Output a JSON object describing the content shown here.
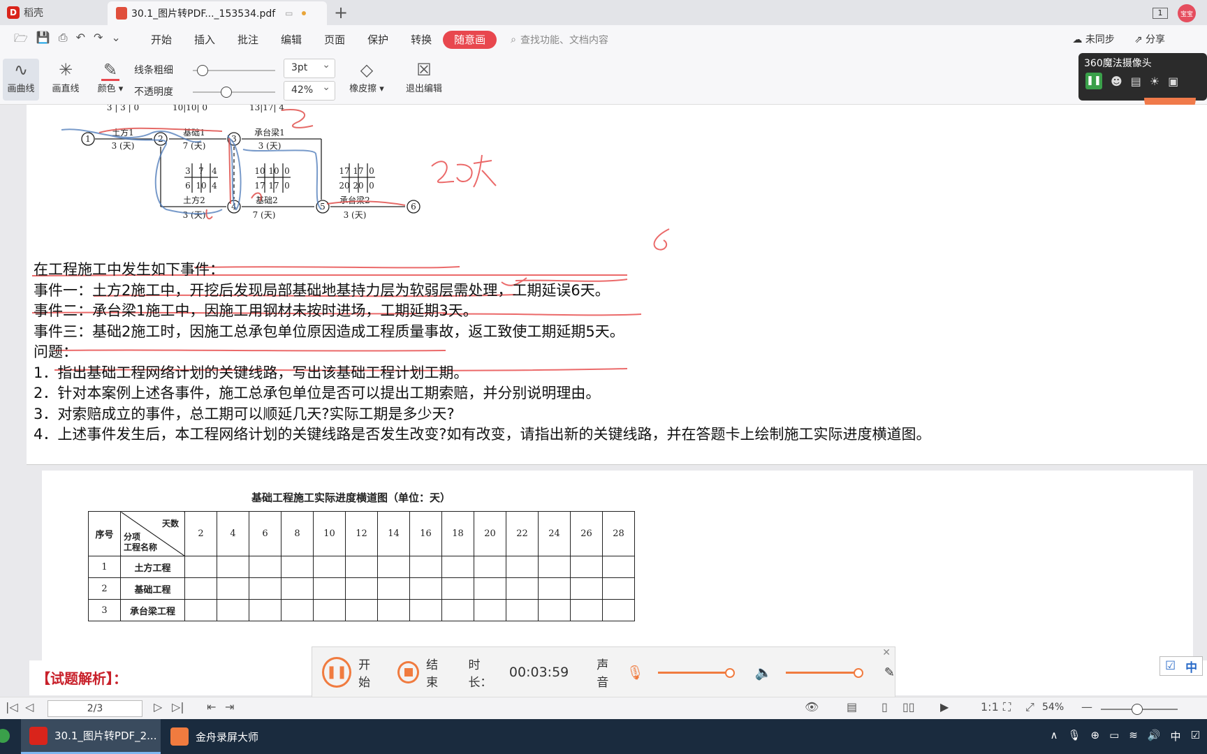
{
  "titlebar": {
    "home_tab": "稻壳",
    "doc_tab": "30.1_图片转PDF..._153534.pdf",
    "window_count": "1",
    "avatar_text": "宝宝"
  },
  "menubar": {
    "items": [
      "开始",
      "插入",
      "批注",
      "编辑",
      "页面",
      "保护",
      "转换",
      "随意画"
    ],
    "active": "随意画",
    "search_placeholder": "查找功能、文档内容",
    "sync": "未同步",
    "share": "分享"
  },
  "drawbar": {
    "freehand": "画曲线",
    "straight": "画直线",
    "color": "颜色",
    "thickness_label": "线条粗细",
    "thickness_value": "3pt",
    "opacity_label": "不透明度",
    "opacity_value": "42%",
    "eraser": "橡皮擦",
    "exit": "退出编辑"
  },
  "camera": {
    "title": "360魔法摄像头"
  },
  "network": {
    "top_labels": [
      {
        "text": "3 | 3 | 0"
      },
      {
        "text": "10|10| 0"
      },
      {
        "text": "13|17| 4"
      }
    ],
    "nodes": [
      "1",
      "2",
      "3",
      "4",
      "5",
      "6"
    ],
    "activities": [
      {
        "name": "土方1",
        "duration": "3 (天)"
      },
      {
        "name": "基础1",
        "duration": "7 (天)"
      },
      {
        "name": "承台梁1",
        "duration": "3 (天)"
      },
      {
        "name": "土方2",
        "duration": "3 (天)"
      },
      {
        "name": "基础2",
        "duration": "7 (天)"
      },
      {
        "name": "承台梁2",
        "duration": "3 (天)"
      }
    ],
    "grid_a": [
      "3",
      "7",
      "4",
      "6",
      "10",
      "4"
    ],
    "grid_b": [
      "10",
      "10",
      "0",
      "17",
      "17",
      "0"
    ],
    "grid_c": [
      "17",
      "17",
      "0",
      "20",
      "20",
      "0"
    ],
    "handwriting": "20天"
  },
  "question": {
    "lines": [
      "在工程施工中发生如下事件：",
      "事件一：土方2施工中，开挖后发现局部基础地基持力层为软弱层需处理，工期延误6天。",
      "事件二：承台梁1施工中，因施工用钢材未按时进场，工期延期3天。",
      "事件三：基础2施工时，因施工总承包单位原因造成工程质量事故，返工致使工期延期5天。",
      "问题：",
      "1．指出基础工程网络计划的关键线路，写出该基础工程计划工期。",
      "2．针对本案例上述各事件，施工总承包单位是否可以提出工期索赔，并分别说明理由。",
      "3．对索赔成立的事件，总工期可以顺延几天?实际工期是多少天?",
      "4．上述事件发生后，本工程网络计划的关键线路是否发生改变?如有改变，请指出新的关键线路，并在答题卡上绘制施工实际进度横道图。"
    ]
  },
  "gantt": {
    "title": "基础工程施工实际进度横道图（单位：天）",
    "col_no": "序号",
    "diag_top": "天数",
    "diag_bottom_1": "分项",
    "diag_bottom_2": "工程名称",
    "days": [
      "2",
      "4",
      "6",
      "8",
      "10",
      "12",
      "14",
      "16",
      "18",
      "20",
      "22",
      "24",
      "26",
      "28"
    ],
    "rows": [
      {
        "no": "1",
        "name": "土方工程"
      },
      {
        "no": "2",
        "name": "基础工程"
      },
      {
        "no": "3",
        "name": "承台梁工程"
      }
    ]
  },
  "answer": {
    "label": "【试题解析】："
  },
  "recorder": {
    "start": "开始",
    "stop": "结束",
    "duration_label": "时长：",
    "duration": "00:03:59",
    "sound": "声音"
  },
  "ime": {
    "mode": "中"
  },
  "statusbar": {
    "page": "2/3",
    "zoom": "54%"
  },
  "taskbar": {
    "task1": "30.1_图片转PDF_2...",
    "task2": "金舟录屏大师",
    "tray_lang": "中"
  }
}
